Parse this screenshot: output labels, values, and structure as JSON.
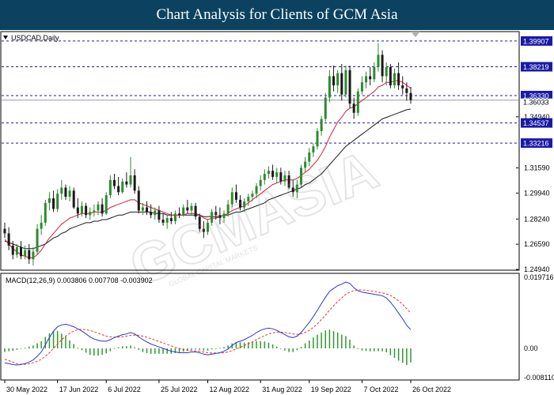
{
  "header": {
    "title": "Chart Analysis for Clients of GCM Asia"
  },
  "symbol_label": "USDCAD,Daily",
  "macd_label": "MACD(12,26,9) 0.003806 0.007708 -0.003902",
  "watermark": "GCMASIA",
  "watermark_small": "GLOBAL CAPITAL MARKETS",
  "colors": {
    "bull_candle": "#2f8a2f",
    "bear_candle": "#1a1a1a",
    "ma_fast": "#d21f3c",
    "ma_slow": "#1a1a1a",
    "level_line": "#1a1aa8",
    "price_box": "#1a1aa8",
    "macd_line": "#2838d8",
    "signal_line": "#e23a2a",
    "histogram": "#2f9a2f"
  },
  "chart_data": {
    "type": "candlestick",
    "symbol": "USDCAD",
    "timeframe": "Daily",
    "y_ticks": [
      "1.39907",
      "1.38219",
      "1.36330",
      "1.36033",
      "1.34940",
      "1.34537",
      "1.33216",
      "1.31590",
      "1.29940",
      "1.28240",
      "1.26590",
      "1.24940"
    ],
    "ylim": [
      1.2494,
      1.4047
    ],
    "levels": [
      {
        "value": 1.39907,
        "label": "1.39907"
      },
      {
        "value": 1.38219,
        "label": "1.38219"
      },
      {
        "value": 1.3633,
        "label": "1.36330"
      },
      {
        "value": 1.34537,
        "label": "1.34537"
      },
      {
        "value": 1.33216,
        "label": "1.33216"
      }
    ],
    "current_price": {
      "value": 1.36033,
      "label": "1.36033"
    },
    "grid_ticks": [
      {
        "value": 1.3494,
        "label": "1.34940"
      },
      {
        "value": 1.3159,
        "label": "1.31590"
      },
      {
        "value": 1.2994,
        "label": "1.29940"
      },
      {
        "value": 1.2824,
        "label": "1.28240"
      },
      {
        "value": 1.2659,
        "label": "1.26590"
      },
      {
        "value": 1.2494,
        "label": "1.24940"
      }
    ],
    "x_labels": [
      "30 May 2022",
      "17 Jun 2022",
      "6 Jul 2022",
      "25 Jul 2022",
      "12 Aug 2022",
      "31 Aug 2022",
      "19 Sep 2022",
      "7 Oct 2022",
      "26 Oct 2022"
    ],
    "candles": [
      {
        "o": 1.276,
        "h": 1.28,
        "l": 1.27,
        "c": 1.273
      },
      {
        "o": 1.273,
        "h": 1.277,
        "l": 1.262,
        "c": 1.265
      },
      {
        "o": 1.265,
        "h": 1.268,
        "l": 1.256,
        "c": 1.259
      },
      {
        "o": 1.259,
        "h": 1.266,
        "l": 1.257,
        "c": 1.264
      },
      {
        "o": 1.264,
        "h": 1.268,
        "l": 1.256,
        "c": 1.258
      },
      {
        "o": 1.258,
        "h": 1.265,
        "l": 1.256,
        "c": 1.262
      },
      {
        "o": 1.262,
        "h": 1.266,
        "l": 1.253,
        "c": 1.256
      },
      {
        "o": 1.256,
        "h": 1.264,
        "l": 1.252,
        "c": 1.261
      },
      {
        "o": 1.261,
        "h": 1.279,
        "l": 1.259,
        "c": 1.276
      },
      {
        "o": 1.276,
        "h": 1.285,
        "l": 1.272,
        "c": 1.28
      },
      {
        "o": 1.28,
        "h": 1.295,
        "l": 1.278,
        "c": 1.293
      },
      {
        "o": 1.293,
        "h": 1.3,
        "l": 1.288,
        "c": 1.296
      },
      {
        "o": 1.296,
        "h": 1.301,
        "l": 1.287,
        "c": 1.289
      },
      {
        "o": 1.289,
        "h": 1.302,
        "l": 1.287,
        "c": 1.299
      },
      {
        "o": 1.299,
        "h": 1.308,
        "l": 1.295,
        "c": 1.303
      },
      {
        "o": 1.303,
        "h": 1.305,
        "l": 1.295,
        "c": 1.297
      },
      {
        "o": 1.297,
        "h": 1.304,
        "l": 1.294,
        "c": 1.301
      },
      {
        "o": 1.301,
        "h": 1.303,
        "l": 1.289,
        "c": 1.29
      },
      {
        "o": 1.29,
        "h": 1.296,
        "l": 1.283,
        "c": 1.286
      },
      {
        "o": 1.286,
        "h": 1.294,
        "l": 1.284,
        "c": 1.291
      },
      {
        "o": 1.291,
        "h": 1.293,
        "l": 1.283,
        "c": 1.285
      },
      {
        "o": 1.285,
        "h": 1.29,
        "l": 1.282,
        "c": 1.287
      },
      {
        "o": 1.287,
        "h": 1.292,
        "l": 1.284,
        "c": 1.288
      },
      {
        "o": 1.288,
        "h": 1.294,
        "l": 1.285,
        "c": 1.292
      },
      {
        "o": 1.292,
        "h": 1.296,
        "l": 1.284,
        "c": 1.286
      },
      {
        "o": 1.286,
        "h": 1.3,
        "l": 1.285,
        "c": 1.298
      },
      {
        "o": 1.298,
        "h": 1.311,
        "l": 1.296,
        "c": 1.308
      },
      {
        "o": 1.308,
        "h": 1.312,
        "l": 1.302,
        "c": 1.304
      },
      {
        "o": 1.304,
        "h": 1.31,
        "l": 1.298,
        "c": 1.3
      },
      {
        "o": 1.3,
        "h": 1.309,
        "l": 1.299,
        "c": 1.307
      },
      {
        "o": 1.307,
        "h": 1.313,
        "l": 1.303,
        "c": 1.305
      },
      {
        "o": 1.305,
        "h": 1.323,
        "l": 1.303,
        "c": 1.311
      },
      {
        "o": 1.311,
        "h": 1.315,
        "l": 1.299,
        "c": 1.301
      },
      {
        "o": 1.301,
        "h": 1.304,
        "l": 1.286,
        "c": 1.288
      },
      {
        "o": 1.288,
        "h": 1.293,
        "l": 1.285,
        "c": 1.29
      },
      {
        "o": 1.29,
        "h": 1.294,
        "l": 1.285,
        "c": 1.287
      },
      {
        "o": 1.287,
        "h": 1.292,
        "l": 1.283,
        "c": 1.285
      },
      {
        "o": 1.285,
        "h": 1.29,
        "l": 1.282,
        "c": 1.288
      },
      {
        "o": 1.288,
        "h": 1.291,
        "l": 1.28,
        "c": 1.282
      },
      {
        "o": 1.282,
        "h": 1.286,
        "l": 1.278,
        "c": 1.28
      },
      {
        "o": 1.28,
        "h": 1.285,
        "l": 1.276,
        "c": 1.283
      },
      {
        "o": 1.283,
        "h": 1.287,
        "l": 1.279,
        "c": 1.281
      },
      {
        "o": 1.281,
        "h": 1.288,
        "l": 1.279,
        "c": 1.286
      },
      {
        "o": 1.286,
        "h": 1.29,
        "l": 1.283,
        "c": 1.285
      },
      {
        "o": 1.285,
        "h": 1.292,
        "l": 1.284,
        "c": 1.29
      },
      {
        "o": 1.29,
        "h": 1.295,
        "l": 1.286,
        "c": 1.288
      },
      {
        "o": 1.288,
        "h": 1.293,
        "l": 1.285,
        "c": 1.291
      },
      {
        "o": 1.291,
        "h": 1.293,
        "l": 1.282,
        "c": 1.284
      },
      {
        "o": 1.284,
        "h": 1.286,
        "l": 1.274,
        "c": 1.276
      },
      {
        "o": 1.276,
        "h": 1.281,
        "l": 1.27,
        "c": 1.274
      },
      {
        "o": 1.274,
        "h": 1.282,
        "l": 1.272,
        "c": 1.28
      },
      {
        "o": 1.28,
        "h": 1.289,
        "l": 1.278,
        "c": 1.287
      },
      {
        "o": 1.287,
        "h": 1.291,
        "l": 1.282,
        "c": 1.285
      },
      {
        "o": 1.285,
        "h": 1.29,
        "l": 1.279,
        "c": 1.283
      },
      {
        "o": 1.283,
        "h": 1.288,
        "l": 1.28,
        "c": 1.286
      },
      {
        "o": 1.286,
        "h": 1.295,
        "l": 1.284,
        "c": 1.292
      },
      {
        "o": 1.292,
        "h": 1.303,
        "l": 1.29,
        "c": 1.3
      },
      {
        "o": 1.3,
        "h": 1.305,
        "l": 1.293,
        "c": 1.295
      },
      {
        "o": 1.295,
        "h": 1.298,
        "l": 1.288,
        "c": 1.29
      },
      {
        "o": 1.29,
        "h": 1.296,
        "l": 1.287,
        "c": 1.294
      },
      {
        "o": 1.294,
        "h": 1.299,
        "l": 1.291,
        "c": 1.297
      },
      {
        "o": 1.297,
        "h": 1.301,
        "l": 1.294,
        "c": 1.299
      },
      {
        "o": 1.299,
        "h": 1.306,
        "l": 1.296,
        "c": 1.304
      },
      {
        "o": 1.304,
        "h": 1.311,
        "l": 1.301,
        "c": 1.308
      },
      {
        "o": 1.308,
        "h": 1.315,
        "l": 1.305,
        "c": 1.312
      },
      {
        "o": 1.312,
        "h": 1.317,
        "l": 1.309,
        "c": 1.314
      },
      {
        "o": 1.314,
        "h": 1.318,
        "l": 1.308,
        "c": 1.31
      },
      {
        "o": 1.31,
        "h": 1.316,
        "l": 1.306,
        "c": 1.313
      },
      {
        "o": 1.313,
        "h": 1.316,
        "l": 1.305,
        "c": 1.307
      },
      {
        "o": 1.307,
        "h": 1.314,
        "l": 1.304,
        "c": 1.311
      },
      {
        "o": 1.311,
        "h": 1.314,
        "l": 1.302,
        "c": 1.303
      },
      {
        "o": 1.303,
        "h": 1.308,
        "l": 1.297,
        "c": 1.3
      },
      {
        "o": 1.3,
        "h": 1.308,
        "l": 1.296,
        "c": 1.305
      },
      {
        "o": 1.305,
        "h": 1.318,
        "l": 1.303,
        "c": 1.316
      },
      {
        "o": 1.316,
        "h": 1.323,
        "l": 1.313,
        "c": 1.32
      },
      {
        "o": 1.32,
        "h": 1.329,
        "l": 1.317,
        "c": 1.326
      },
      {
        "o": 1.326,
        "h": 1.332,
        "l": 1.323,
        "c": 1.33
      },
      {
        "o": 1.33,
        "h": 1.342,
        "l": 1.328,
        "c": 1.34
      },
      {
        "o": 1.34,
        "h": 1.35,
        "l": 1.337,
        "c": 1.348
      },
      {
        "o": 1.348,
        "h": 1.365,
        "l": 1.346,
        "c": 1.362
      },
      {
        "o": 1.362,
        "h": 1.38,
        "l": 1.359,
        "c": 1.376
      },
      {
        "o": 1.376,
        "h": 1.383,
        "l": 1.366,
        "c": 1.37
      },
      {
        "o": 1.37,
        "h": 1.38,
        "l": 1.365,
        "c": 1.378
      },
      {
        "o": 1.378,
        "h": 1.384,
        "l": 1.36,
        "c": 1.364
      },
      {
        "o": 1.364,
        "h": 1.383,
        "l": 1.362,
        "c": 1.38
      },
      {
        "o": 1.38,
        "h": 1.383,
        "l": 1.355,
        "c": 1.358
      },
      {
        "o": 1.358,
        "h": 1.362,
        "l": 1.348,
        "c": 1.352
      },
      {
        "o": 1.352,
        "h": 1.368,
        "l": 1.35,
        "c": 1.366
      },
      {
        "o": 1.366,
        "h": 1.376,
        "l": 1.364,
        "c": 1.372
      },
      {
        "o": 1.372,
        "h": 1.379,
        "l": 1.368,
        "c": 1.376
      },
      {
        "o": 1.376,
        "h": 1.382,
        "l": 1.37,
        "c": 1.374
      },
      {
        "o": 1.374,
        "h": 1.385,
        "l": 1.372,
        "c": 1.382
      },
      {
        "o": 1.382,
        "h": 1.3977,
        "l": 1.379,
        "c": 1.39
      },
      {
        "o": 1.39,
        "h": 1.393,
        "l": 1.372,
        "c": 1.376
      },
      {
        "o": 1.376,
        "h": 1.385,
        "l": 1.37,
        "c": 1.382
      },
      {
        "o": 1.382,
        "h": 1.384,
        "l": 1.368,
        "c": 1.37
      },
      {
        "o": 1.37,
        "h": 1.381,
        "l": 1.368,
        "c": 1.378
      },
      {
        "o": 1.378,
        "h": 1.385,
        "l": 1.367,
        "c": 1.37
      },
      {
        "o": 1.37,
        "h": 1.376,
        "l": 1.364,
        "c": 1.368
      },
      {
        "o": 1.368,
        "h": 1.372,
        "l": 1.36,
        "c": 1.365
      },
      {
        "o": 1.365,
        "h": 1.369,
        "l": 1.358,
        "c": 1.3603
      }
    ],
    "ma_fast": [
      1.269,
      1.266,
      1.263,
      1.261,
      1.259,
      1.258,
      1.257,
      1.257,
      1.259,
      1.262,
      1.266,
      1.27,
      1.273,
      1.276,
      1.279,
      1.281,
      1.283,
      1.284,
      1.285,
      1.286,
      1.286,
      1.286,
      1.287,
      1.287,
      1.287,
      1.288,
      1.29,
      1.291,
      1.292,
      1.293,
      1.294,
      1.295,
      1.295,
      1.293,
      1.292,
      1.291,
      1.29,
      1.289,
      1.288,
      1.287,
      1.286,
      1.285,
      1.285,
      1.285,
      1.285,
      1.286,
      1.286,
      1.286,
      1.285,
      1.283,
      1.282,
      1.283,
      1.283,
      1.284,
      1.285,
      1.286,
      1.288,
      1.289,
      1.29,
      1.291,
      1.293,
      1.295,
      1.297,
      1.299,
      1.301,
      1.303,
      1.305,
      1.306,
      1.307,
      1.308,
      1.308,
      1.308,
      1.309,
      1.311,
      1.313,
      1.315,
      1.318,
      1.321,
      1.325,
      1.33,
      1.336,
      1.341,
      1.346,
      1.349,
      1.353,
      1.355,
      1.356,
      1.358,
      1.36,
      1.362,
      1.364,
      1.366,
      1.369,
      1.37,
      1.372,
      1.372,
      1.373,
      1.373,
      1.372,
      1.37,
      1.368
    ],
    "ma_slow": [
      1.268,
      1.267,
      1.266,
      1.265,
      1.264,
      1.263,
      1.263,
      1.263,
      1.264,
      1.265,
      1.266,
      1.268,
      1.27,
      1.271,
      1.273,
      1.274,
      1.276,
      1.277,
      1.278,
      1.279,
      1.28,
      1.28,
      1.281,
      1.281,
      1.282,
      1.282,
      1.283,
      1.284,
      1.285,
      1.285,
      1.286,
      1.287,
      1.287,
      1.287,
      1.287,
      1.287,
      1.287,
      1.286,
      1.286,
      1.286,
      1.285,
      1.285,
      1.285,
      1.285,
      1.285,
      1.285,
      1.285,
      1.285,
      1.285,
      1.284,
      1.284,
      1.284,
      1.284,
      1.284,
      1.285,
      1.285,
      1.286,
      1.287,
      1.287,
      1.288,
      1.289,
      1.29,
      1.291,
      1.292,
      1.293,
      1.295,
      1.296,
      1.297,
      1.298,
      1.299,
      1.3,
      1.301,
      1.302,
      1.303,
      1.305,
      1.306,
      1.308,
      1.31,
      1.312,
      1.315,
      1.318,
      1.321,
      1.324,
      1.327,
      1.33,
      1.332,
      1.334,
      1.336,
      1.338,
      1.34,
      1.342,
      1.344,
      1.346,
      1.348,
      1.349,
      1.35,
      1.351,
      1.352,
      1.353,
      1.354,
      1.3545
    ],
    "macd": {
      "y_ticks": [
        "0.019716",
        "0.00",
        "-0.008110"
      ],
      "ylim": [
        -0.00811,
        0.019716
      ],
      "macd": [
        -0.004,
        -0.0042,
        -0.0045,
        -0.0046,
        -0.0045,
        -0.0042,
        -0.0038,
        -0.0032,
        -0.0022,
        -0.001,
        0.001,
        0.003,
        0.0048,
        0.006,
        0.0065,
        0.0067,
        0.0064,
        0.006,
        0.0054,
        0.0048,
        0.004,
        0.0032,
        0.0026,
        0.0022,
        0.002,
        0.002,
        0.0024,
        0.003,
        0.0034,
        0.0038,
        0.004,
        0.0044,
        0.004,
        0.0032,
        0.0024,
        0.0018,
        0.0012,
        0.0008,
        0.0004,
        0.0,
        -0.0004,
        -0.0008,
        -0.001,
        -0.0012,
        -0.0012,
        -0.0012,
        -0.001,
        -0.001,
        -0.0012,
        -0.0016,
        -0.0018,
        -0.0016,
        -0.0014,
        -0.0012,
        -0.0008,
        -0.0002,
        0.0008,
        0.0016,
        0.002,
        0.0024,
        0.003,
        0.0036,
        0.0044,
        0.005,
        0.0054,
        0.0056,
        0.0054,
        0.005,
        0.0044,
        0.0038,
        0.0032,
        0.003,
        0.0034,
        0.0044,
        0.0058,
        0.0072,
        0.0088,
        0.0106,
        0.0124,
        0.0142,
        0.0158,
        0.0166,
        0.0174,
        0.0178,
        0.0184,
        0.018,
        0.0168,
        0.016,
        0.0156,
        0.0154,
        0.0152,
        0.015,
        0.0148,
        0.0146,
        0.014,
        0.0128,
        0.0114,
        0.0098,
        0.0082,
        0.0064,
        0.0052
      ],
      "signal": [
        -0.003,
        -0.0034,
        -0.0038,
        -0.0042,
        -0.0044,
        -0.0044,
        -0.0043,
        -0.004,
        -0.0036,
        -0.003,
        -0.0022,
        -0.0012,
        0.0,
        0.0012,
        0.0024,
        0.0034,
        0.0042,
        0.0048,
        0.0052,
        0.0053,
        0.0052,
        0.005,
        0.0046,
        0.0042,
        0.0038,
        0.0034,
        0.0032,
        0.0031,
        0.0031,
        0.0032,
        0.0034,
        0.0036,
        0.0037,
        0.0036,
        0.0034,
        0.0031,
        0.0027,
        0.0023,
        0.0019,
        0.0015,
        0.0011,
        0.0007,
        0.0003,
        0.0,
        -0.0003,
        -0.0005,
        -0.0006,
        -0.0007,
        -0.0008,
        -0.001,
        -0.0012,
        -0.0013,
        -0.0013,
        -0.0013,
        -0.0012,
        -0.001,
        -0.0006,
        -0.0002,
        0.0003,
        0.0008,
        0.0013,
        0.0018,
        0.0024,
        0.003,
        0.0035,
        0.004,
        0.0043,
        0.0045,
        0.0045,
        0.0044,
        0.0042,
        0.004,
        0.0039,
        0.004,
        0.0044,
        0.005,
        0.0058,
        0.0068,
        0.008,
        0.0092,
        0.0106,
        0.0118,
        0.013,
        0.014,
        0.015,
        0.0156,
        0.016,
        0.0162,
        0.0162,
        0.0161,
        0.016,
        0.0158,
        0.0156,
        0.0154,
        0.0151,
        0.0147,
        0.014,
        0.0132,
        0.0122,
        0.011,
        0.0098
      ],
      "hist": [
        -0.001,
        -0.0008,
        -0.0007,
        -0.0004,
        -0.0001,
        0.0002,
        0.0005,
        0.0008,
        0.0014,
        0.002,
        0.0032,
        0.0042,
        0.0048,
        0.0048,
        0.0041,
        0.0033,
        0.0022,
        0.0012,
        0.0002,
        -0.0005,
        -0.0012,
        -0.0018,
        -0.002,
        -0.002,
        -0.0018,
        -0.0014,
        -0.0008,
        -0.0001,
        0.0003,
        0.0006,
        0.0006,
        0.0008,
        0.0003,
        -0.0004,
        -0.001,
        -0.0013,
        -0.0015,
        -0.0015,
        -0.0015,
        -0.0015,
        -0.0015,
        -0.0015,
        -0.0013,
        -0.0012,
        -0.0009,
        -0.0007,
        -0.0004,
        -0.0003,
        -0.0004,
        -0.0006,
        -0.0006,
        -0.0003,
        -0.0001,
        0.0001,
        0.0004,
        0.0008,
        0.0014,
        0.0018,
        0.0017,
        0.0016,
        0.0017,
        0.0018,
        0.002,
        0.002,
        0.0019,
        0.0016,
        0.0011,
        0.0005,
        -0.0001,
        -0.0006,
        -0.001,
        -0.001,
        -0.0005,
        0.0004,
        0.0014,
        0.0022,
        0.003,
        0.0038,
        0.0044,
        0.005,
        0.0052,
        0.0048,
        0.0044,
        0.0038,
        0.0034,
        0.0024,
        0.0008,
        -0.0002,
        -0.0006,
        -0.0007,
        -0.0008,
        -0.0008,
        -0.0008,
        -0.0008,
        -0.0011,
        -0.0019,
        -0.0026,
        -0.0034,
        -0.004,
        -0.0046,
        -0.0039
      ]
    }
  }
}
